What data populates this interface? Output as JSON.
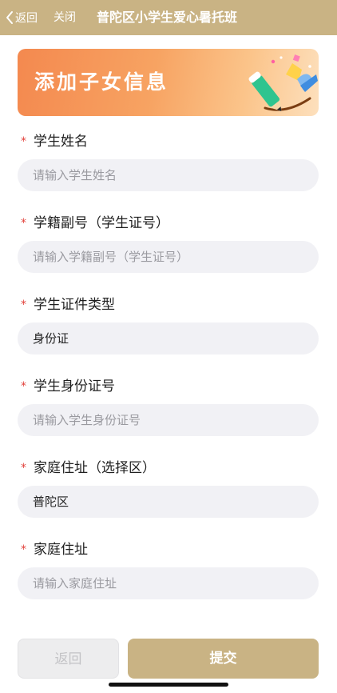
{
  "nav": {
    "back_label": "返回",
    "close_label": "关闭",
    "title": "普陀区小学生爱心暑托班"
  },
  "banner": {
    "title": "添加子女信息"
  },
  "form": {
    "required_mark": "*",
    "fields": [
      {
        "label": "学生姓名",
        "value": "",
        "placeholder": "请输入学生姓名"
      },
      {
        "label": "学籍副号（学生证号）",
        "value": "",
        "placeholder": "请输入学籍副号（学生证号）"
      },
      {
        "label": "学生证件类型",
        "value": "身份证",
        "placeholder": ""
      },
      {
        "label": "学生身份证号",
        "value": "",
        "placeholder": "请输入学生身份证号"
      },
      {
        "label": "家庭住址（选择区）",
        "value": "普陀区",
        "placeholder": ""
      },
      {
        "label": "家庭住址",
        "value": "",
        "placeholder": "请输入家庭住址"
      }
    ]
  },
  "actions": {
    "back_label": "返回",
    "submit_label": "提交"
  },
  "colors": {
    "accent": "#c9b384",
    "required": "#e2423b",
    "banner_orange": "#f4894f"
  }
}
